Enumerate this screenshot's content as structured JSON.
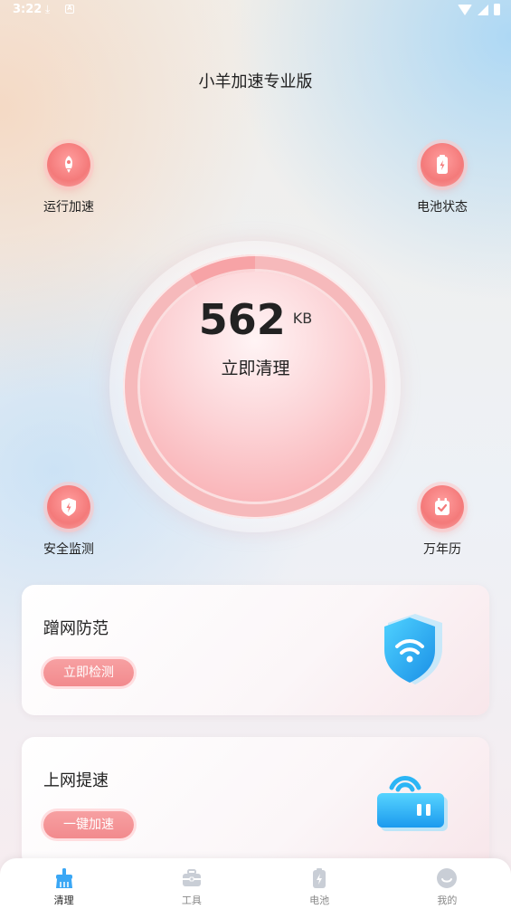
{
  "status_bar": {
    "time": "3:22"
  },
  "app": {
    "title": "小羊加速专业版"
  },
  "features": {
    "run_boost": "运行加速",
    "battery_status": "电池状态",
    "security_monitor": "安全监测",
    "calendar": "万年历"
  },
  "gauge": {
    "value": "562",
    "unit": "KB",
    "action": "立即清理"
  },
  "cards": [
    {
      "title": "蹭网防范",
      "button": "立即检测"
    },
    {
      "title": "上网提速",
      "button": "一键加速"
    }
  ],
  "nav": [
    {
      "label": "清理",
      "icon": "broom-icon",
      "active": true
    },
    {
      "label": "工具",
      "icon": "toolbox-icon",
      "active": false
    },
    {
      "label": "电池",
      "icon": "battery-icon",
      "active": false
    },
    {
      "label": "我的",
      "icon": "profile-icon",
      "active": false
    }
  ],
  "colors": {
    "accent": "#f28a8d",
    "nav_active": "#3aa7f5",
    "nav_inactive": "#c9ced6"
  }
}
